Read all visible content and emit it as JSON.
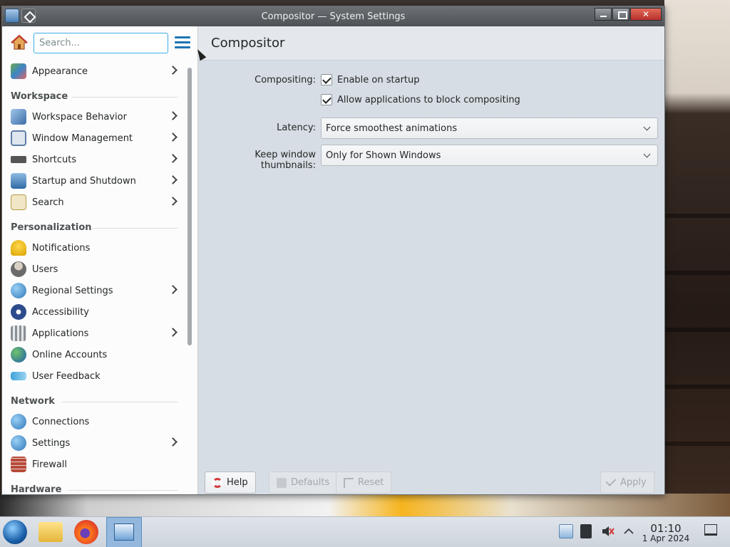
{
  "window": {
    "title": "Compositor — System Settings"
  },
  "sidebar": {
    "search_placeholder": "Search...",
    "top_item": {
      "label": "Appearance",
      "has_children": true
    },
    "categories": [
      {
        "title": "Workspace",
        "items": [
          {
            "label": "Workspace Behavior",
            "has_children": true
          },
          {
            "label": "Window Management",
            "has_children": true
          },
          {
            "label": "Shortcuts",
            "has_children": true
          },
          {
            "label": "Startup and Shutdown",
            "has_children": true
          },
          {
            "label": "Search",
            "has_children": true
          }
        ]
      },
      {
        "title": "Personalization",
        "items": [
          {
            "label": "Notifications",
            "has_children": false
          },
          {
            "label": "Users",
            "has_children": false
          },
          {
            "label": "Regional Settings",
            "has_children": true
          },
          {
            "label": "Accessibility",
            "has_children": false
          },
          {
            "label": "Applications",
            "has_children": true
          },
          {
            "label": "Online Accounts",
            "has_children": false
          },
          {
            "label": "User Feedback",
            "has_children": false
          }
        ]
      },
      {
        "title": "Network",
        "items": [
          {
            "label": "Connections",
            "has_children": false
          },
          {
            "label": "Settings",
            "has_children": true
          },
          {
            "label": "Firewall",
            "has_children": false
          }
        ]
      },
      {
        "title": "Hardware",
        "items": []
      }
    ]
  },
  "page": {
    "title": "Compositor",
    "compositing_label": "Compositing:",
    "enable_on_startup": "Enable on startup",
    "allow_block": "Allow applications to block compositing",
    "latency_label": "Latency:",
    "latency_value": "Force smoothest animations",
    "thumbnails_label": "Keep window thumbnails:",
    "thumbnails_value": "Only for Shown Windows"
  },
  "buttons": {
    "help": "Help",
    "defaults": "Defaults",
    "reset": "Reset",
    "apply": "Apply"
  },
  "taskbar": {
    "time": "01:10",
    "date": "1 Apr 2024"
  }
}
